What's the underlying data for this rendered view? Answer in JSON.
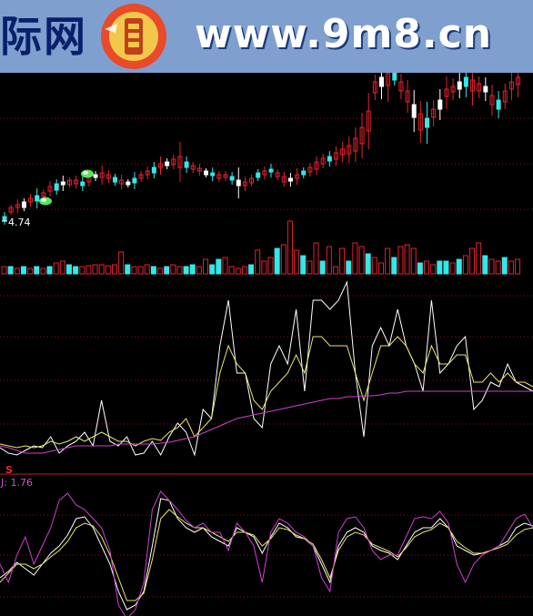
{
  "banner": {
    "left_text": "际网",
    "url_text": "www.9m8.cn",
    "logo_icon": "coin-seal-logo"
  },
  "price_panel": {
    "low_price_label": "4.74"
  },
  "kdj_panel": {
    "j_label": "J: 1.76",
    "signal_marker": "S"
  },
  "colors": {
    "up_candle": "#e8202e",
    "down_candle": "#32e8e8",
    "flat_candle": "#ffffff",
    "line_white": "#ffffff",
    "line_yellow": "#e8e86a",
    "line_magenta": "#d040d0",
    "grid": "#8a1010"
  }
}
